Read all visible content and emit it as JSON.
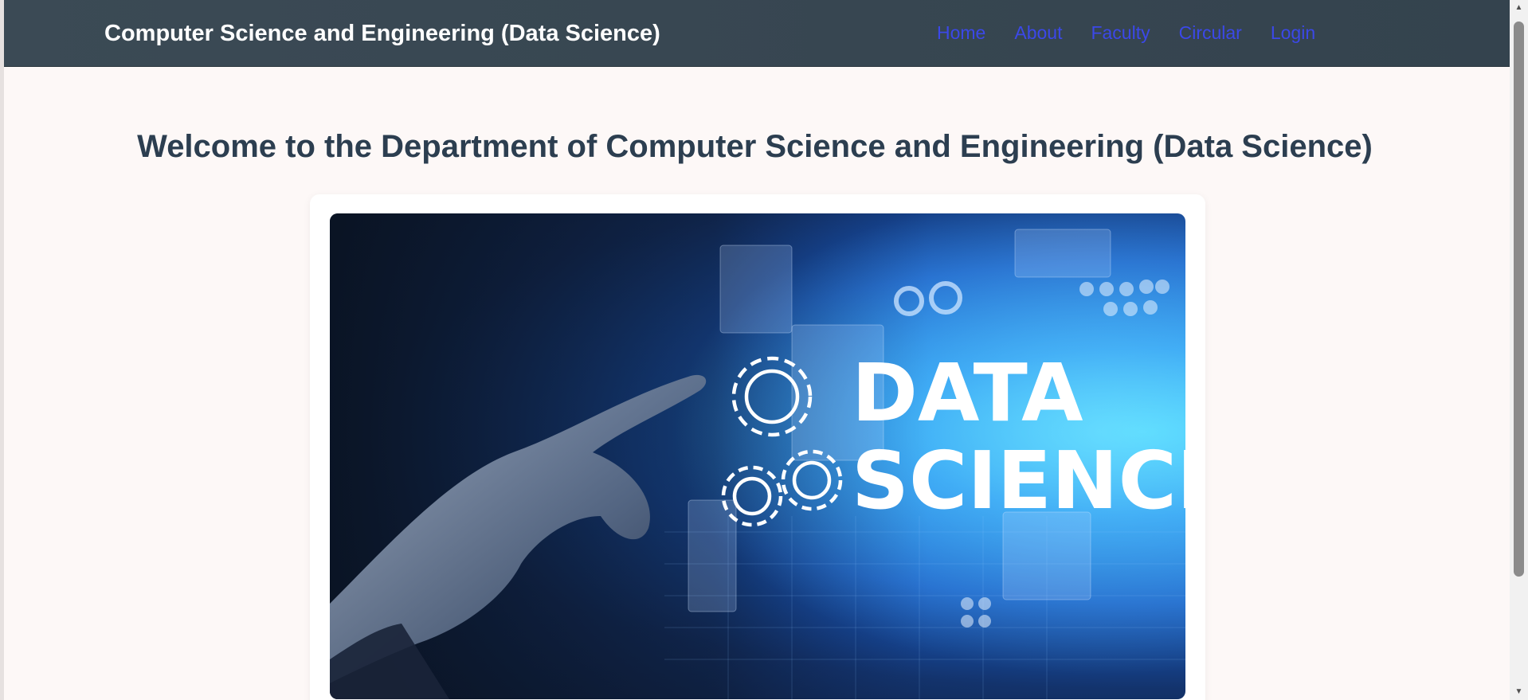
{
  "header": {
    "brand": "Computer Science and Engineering (Data Science)",
    "nav": [
      {
        "label": "Home"
      },
      {
        "label": "About"
      },
      {
        "label": "Faculty"
      },
      {
        "label": "Circular"
      },
      {
        "label": "Login"
      }
    ]
  },
  "main": {
    "headline": "Welcome to the Department of Computer Science and Engineering (Data Science)",
    "hero_image": {
      "text_line1": "DATA",
      "text_line2": "SCIENCE"
    }
  },
  "colors": {
    "navbar": "#3b4a55",
    "nav_link": "#3b48e8",
    "headline": "#2c3e50",
    "page_background": "#fdf8f7"
  },
  "icons": [
    "scroll-up-arrow-icon",
    "scroll-down-arrow-icon"
  ]
}
